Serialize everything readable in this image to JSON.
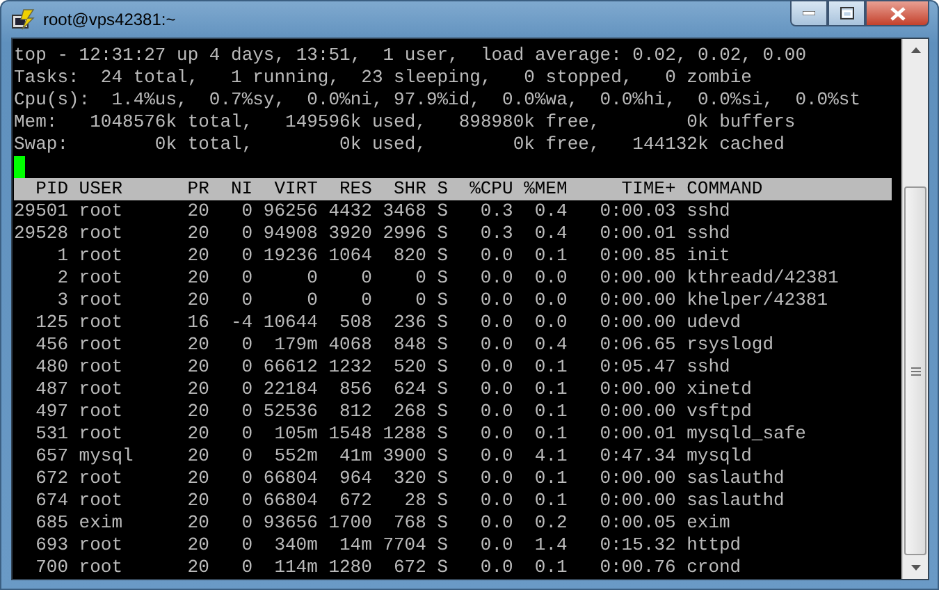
{
  "window": {
    "title": "root@vps42381:~"
  },
  "summary": [
    "top - 12:31:27 up 4 days, 13:51,  1 user,  load average: 0.02, 0.02, 0.00",
    "Tasks:  24 total,   1 running,  23 sleeping,   0 stopped,   0 zombie",
    "Cpu(s):  1.4%us,  0.7%sy,  0.0%ni, 97.9%id,  0.0%wa,  0.0%hi,  0.0%si,  0.0%st",
    "Mem:   1048576k total,   149596k used,   898980k free,        0k buffers",
    "Swap:        0k total,        0k used,        0k free,   144132k cached"
  ],
  "table": {
    "columns": [
      "PID",
      "USER",
      "PR",
      "NI",
      "VIRT",
      "RES",
      "SHR",
      "S",
      "%CPU",
      "%MEM",
      "TIME+",
      "COMMAND"
    ],
    "rows": [
      [
        "29501",
        "root",
        "20",
        "0",
        "96256",
        "4432",
        "3468",
        "S",
        "0.3",
        "0.4",
        "0:00.03",
        "sshd"
      ],
      [
        "29528",
        "root",
        "20",
        "0",
        "94908",
        "3920",
        "2996",
        "S",
        "0.3",
        "0.4",
        "0:00.01",
        "sshd"
      ],
      [
        "1",
        "root",
        "20",
        "0",
        "19236",
        "1064",
        "820",
        "S",
        "0.0",
        "0.1",
        "0:00.85",
        "init"
      ],
      [
        "2",
        "root",
        "20",
        "0",
        "0",
        "0",
        "0",
        "S",
        "0.0",
        "0.0",
        "0:00.00",
        "kthreadd/42381"
      ],
      [
        "3",
        "root",
        "20",
        "0",
        "0",
        "0",
        "0",
        "S",
        "0.0",
        "0.0",
        "0:00.00",
        "khelper/42381"
      ],
      [
        "125",
        "root",
        "16",
        "-4",
        "10644",
        "508",
        "236",
        "S",
        "0.0",
        "0.0",
        "0:00.00",
        "udevd"
      ],
      [
        "456",
        "root",
        "20",
        "0",
        "179m",
        "4068",
        "848",
        "S",
        "0.0",
        "0.4",
        "0:06.65",
        "rsyslogd"
      ],
      [
        "480",
        "root",
        "20",
        "0",
        "66612",
        "1232",
        "520",
        "S",
        "0.0",
        "0.1",
        "0:05.47",
        "sshd"
      ],
      [
        "487",
        "root",
        "20",
        "0",
        "22184",
        "856",
        "624",
        "S",
        "0.0",
        "0.1",
        "0:00.00",
        "xinetd"
      ],
      [
        "497",
        "root",
        "20",
        "0",
        "52536",
        "812",
        "268",
        "S",
        "0.0",
        "0.1",
        "0:00.00",
        "vsftpd"
      ],
      [
        "531",
        "root",
        "20",
        "0",
        "105m",
        "1548",
        "1288",
        "S",
        "0.0",
        "0.1",
        "0:00.01",
        "mysqld_safe"
      ],
      [
        "657",
        "mysql",
        "20",
        "0",
        "552m",
        "41m",
        "3900",
        "S",
        "0.0",
        "4.1",
        "0:47.34",
        "mysqld"
      ],
      [
        "672",
        "root",
        "20",
        "0",
        "66804",
        "964",
        "320",
        "S",
        "0.0",
        "0.1",
        "0:00.00",
        "saslauthd"
      ],
      [
        "674",
        "root",
        "20",
        "0",
        "66804",
        "672",
        "28",
        "S",
        "0.0",
        "0.1",
        "0:00.00",
        "saslauthd"
      ],
      [
        "685",
        "exim",
        "20",
        "0",
        "93656",
        "1700",
        "768",
        "S",
        "0.0",
        "0.2",
        "0:00.05",
        "exim"
      ],
      [
        "693",
        "root",
        "20",
        "0",
        "340m",
        "14m",
        "7704",
        "S",
        "0.0",
        "1.4",
        "0:15.32",
        "httpd"
      ],
      [
        "700",
        "root",
        "20",
        "0",
        "114m",
        "1280",
        "672",
        "S",
        "0.0",
        "0.1",
        "0:00.76",
        "crond"
      ]
    ]
  }
}
